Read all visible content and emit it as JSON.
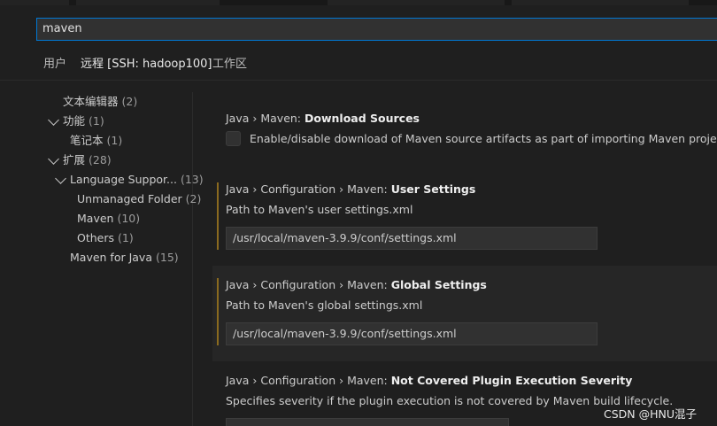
{
  "search": {
    "value": "maven"
  },
  "tabs": [
    {
      "label": "用户"
    },
    {
      "label": "远程 [SSH: hadoop100]"
    },
    {
      "label": "工作区"
    }
  ],
  "toc": [
    {
      "label": "文本编辑器",
      "count": "(2)"
    },
    {
      "label": "功能",
      "count": "(1)"
    },
    {
      "label": "笔记本",
      "count": "(1)"
    },
    {
      "label": "扩展",
      "count": "(28)"
    },
    {
      "label": "Language Suppor...",
      "count": "(13)"
    },
    {
      "label": "Unmanaged Folder",
      "count": "(2)"
    },
    {
      "label": "Maven",
      "count": "(10)"
    },
    {
      "label": "Others",
      "count": "(1)"
    },
    {
      "label": "Maven for Java",
      "count": "(15)"
    }
  ],
  "settings": [
    {
      "category": "Java › Maven: ",
      "name": "Download Sources",
      "description": "Enable/disable download of Maven source artifacts as part of importing Maven projects."
    },
    {
      "category": "Java › Configuration › Maven: ",
      "name": "User Settings",
      "description": "Path to Maven's user settings.xml",
      "value": "/usr/local/maven-3.9.9/conf/settings.xml"
    },
    {
      "category": "Java › Configuration › Maven: ",
      "name": "Global Settings",
      "description": "Path to Maven's global settings.xml",
      "value": "/usr/local/maven-3.9.9/conf/settings.xml"
    },
    {
      "category": "Java › Configuration › Maven: ",
      "name": "Not Covered Plugin Execution Severity",
      "description": "Specifies severity if the plugin execution is not covered by Maven build lifecycle."
    }
  ],
  "watermark": "CSDN @HNU混子"
}
